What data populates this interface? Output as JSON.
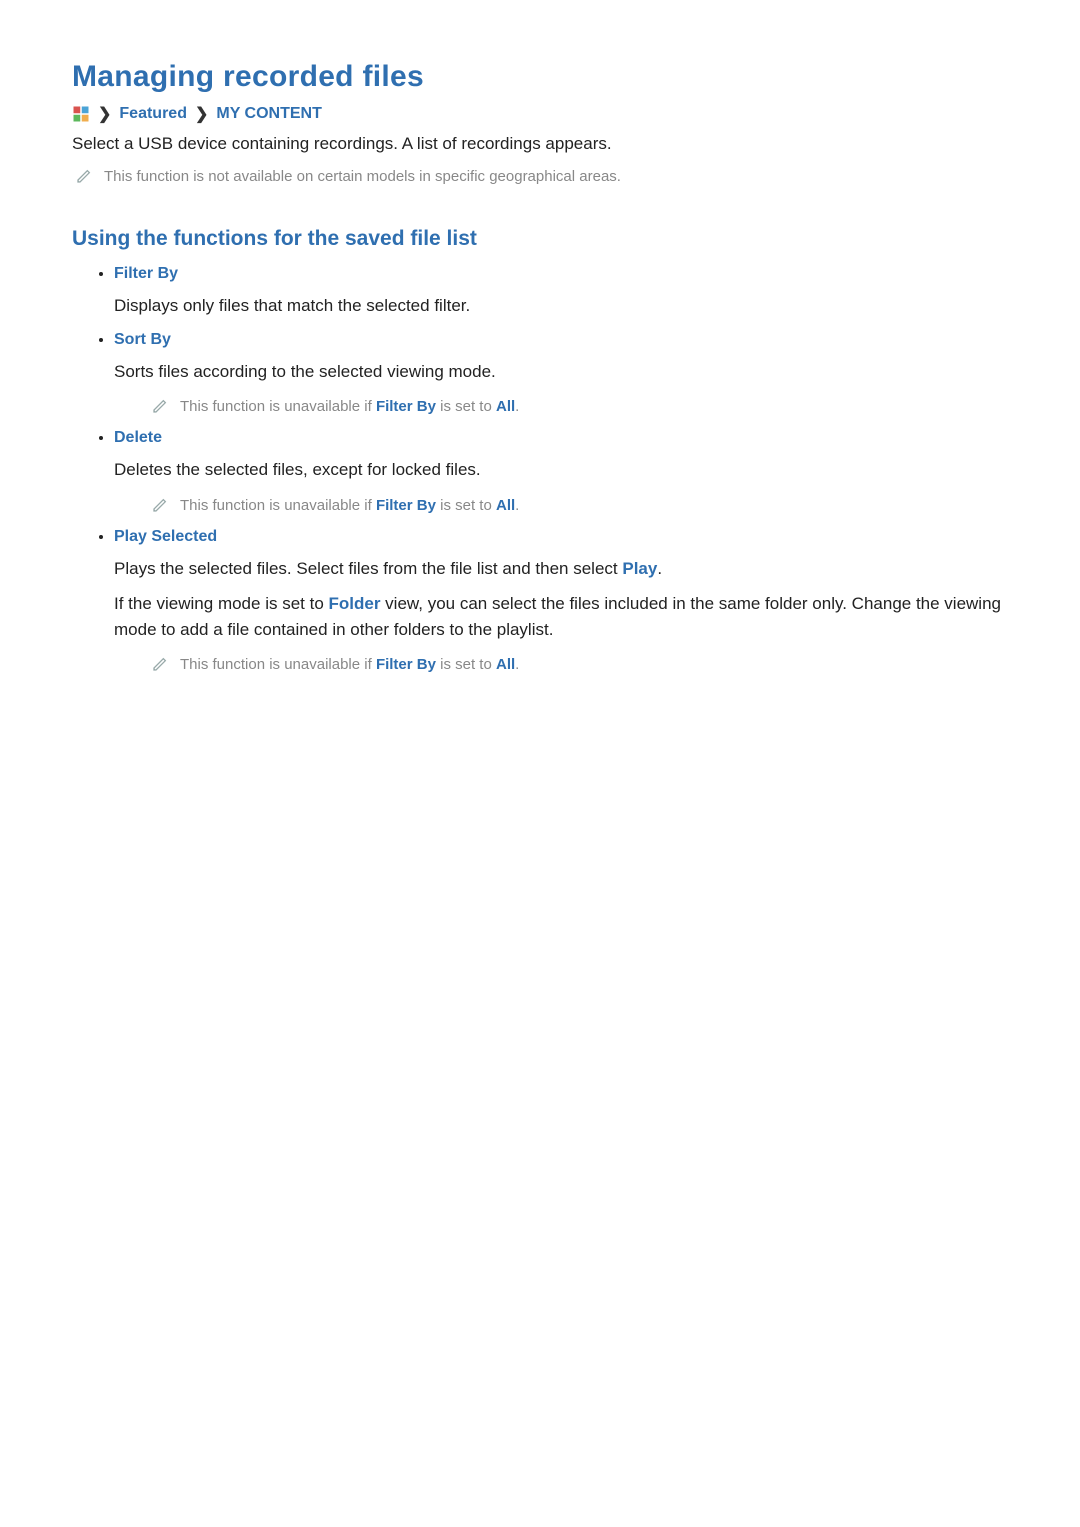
{
  "title": "Managing recorded files",
  "breadcrumb": {
    "featured": "Featured",
    "my_content": "MY CONTENT"
  },
  "intro": "Select a USB device containing recordings. A list of recordings appears.",
  "geo_note": "This function is not available on certain models in specific geographical areas.",
  "section_title": "Using the functions for the saved file list",
  "items": {
    "filter_by": {
      "title": "Filter By",
      "desc": "Displays only files that match the selected filter."
    },
    "sort_by": {
      "title": "Sort By",
      "desc": "Sorts files according to the selected viewing mode.",
      "note_pre": "This function is unavailable if ",
      "note_kw1": "Filter By",
      "note_mid": " is set to ",
      "note_kw2": "All",
      "note_post": "."
    },
    "delete": {
      "title": "Delete",
      "desc": "Deletes the selected files, except for locked files.",
      "note_pre": "This function is unavailable if ",
      "note_kw1": "Filter By",
      "note_mid": " is set to ",
      "note_kw2": "All",
      "note_post": "."
    },
    "play_selected": {
      "title": "Play Selected",
      "desc1_pre": "Plays the selected files. Select files from the file list and then select ",
      "desc1_kw": "Play",
      "desc1_post": ".",
      "desc2_pre": "If the viewing mode is set to ",
      "desc2_kw": "Folder",
      "desc2_post": " view, you can select the files included in the same folder only. Change the viewing mode to add a file contained in other folders to the playlist.",
      "note_pre": "This function is unavailable if ",
      "note_kw1": "Filter By",
      "note_mid": " is set to ",
      "note_kw2": "All",
      "note_post": "."
    }
  }
}
